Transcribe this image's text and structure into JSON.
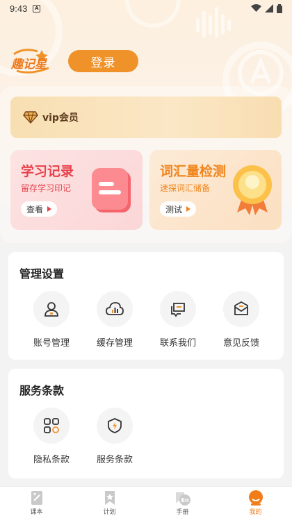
{
  "status_bar": {
    "time": "9:43",
    "notif_letter": "A"
  },
  "header": {
    "logo_text": "趣记星",
    "login_label": "登录"
  },
  "vip": {
    "label": "vip会员"
  },
  "feature_cards": [
    {
      "title": "学习记录",
      "subtitle": "留存学习印记",
      "button": "查看"
    },
    {
      "title": "词汇量检测",
      "subtitle": "速探词汇储备",
      "button": "测试"
    }
  ],
  "manage": {
    "title": "管理设置",
    "items": [
      {
        "label": "账号管理",
        "icon": "user-icon"
      },
      {
        "label": "缓存管理",
        "icon": "cloud-chart-icon"
      },
      {
        "label": "联系我们",
        "icon": "chat-icon"
      },
      {
        "label": "意见反馈",
        "icon": "mail-icon"
      }
    ]
  },
  "terms": {
    "title": "服务条款",
    "items": [
      {
        "label": "隐私条款",
        "icon": "grid-icon"
      },
      {
        "label": "服务条款",
        "icon": "shield-icon"
      }
    ]
  },
  "tabs": [
    {
      "label": "课本",
      "icon": "book-icon",
      "active": false
    },
    {
      "label": "计划",
      "icon": "bookmark-star-icon",
      "active": false
    },
    {
      "label": "手册",
      "icon": "manual-en-icon",
      "active": false
    },
    {
      "label": "我的",
      "icon": "profile-icon",
      "active": true
    }
  ],
  "colors": {
    "accent": "#f0922a",
    "study_red": "#e7414b",
    "vocab_orange": "#f0851c",
    "tab_active": "#f07d1a"
  }
}
